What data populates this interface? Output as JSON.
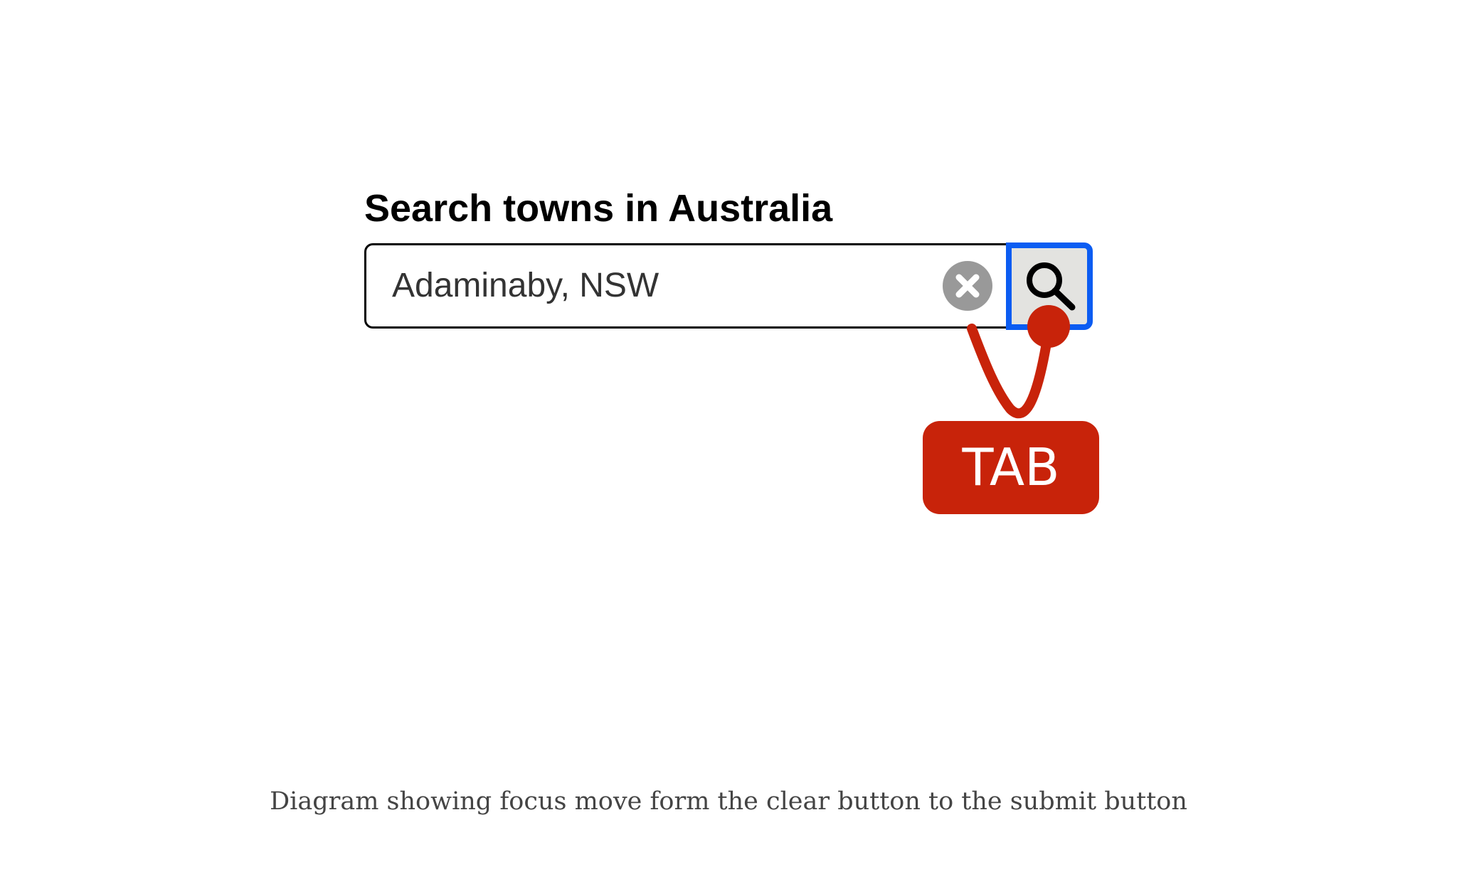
{
  "search": {
    "label": "Search towns in Australia",
    "value": "Adaminaby, NSW",
    "clear_icon": "clear-x-icon",
    "submit_icon": "magnifier-icon",
    "focused_control": "submit-button"
  },
  "annotation": {
    "key_label": "TAB"
  },
  "caption": "Diagram showing focus move form the clear button to the submit button",
  "colors": {
    "focus_ring": "#0b5cf2",
    "annotation_red": "#c8230a",
    "clear_button_grey": "#999999",
    "submit_button_bg": "#e3e3e0"
  }
}
